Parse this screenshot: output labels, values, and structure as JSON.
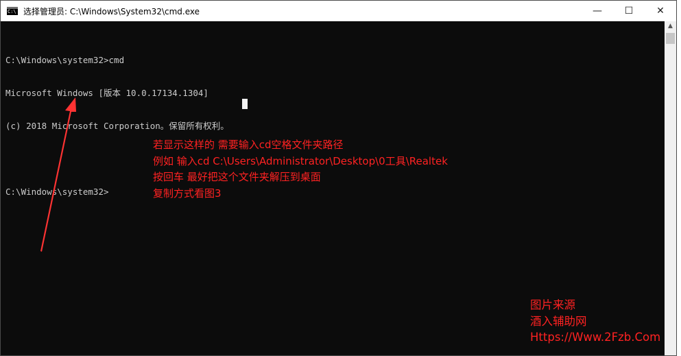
{
  "window": {
    "title": "选择管理员: C:\\Windows\\System32\\cmd.exe",
    "icon": "cmd-icon",
    "controls": {
      "minimize": "—",
      "maximize": "☐",
      "close": "✕"
    }
  },
  "console": {
    "lines": [
      "C:\\Windows\\system32>cmd",
      "Microsoft Windows [版本 10.0.17134.1304]",
      "(c) 2018 Microsoft Corporation。保留所有权利。",
      "",
      "C:\\Windows\\system32>"
    ]
  },
  "annotation": {
    "lines": [
      "若显示这样的 需要输入cd空格文件夹路径",
      "例如 输入cd C:\\Users\\Administrator\\Desktop\\0工具\\Realtek",
      "按回车 最好把这个文件夹解压到桌面",
      "复制方式看图3"
    ],
    "color": "#ff2222"
  },
  "watermark": {
    "lines": [
      "图片来源",
      "酒入辅助网",
      "Https://Www.2Fzb.Com"
    ],
    "color": "#ff2222"
  },
  "colors": {
    "console_bg": "#0c0c0c",
    "console_text": "#cccccc",
    "titlebar_bg": "#ffffff"
  }
}
